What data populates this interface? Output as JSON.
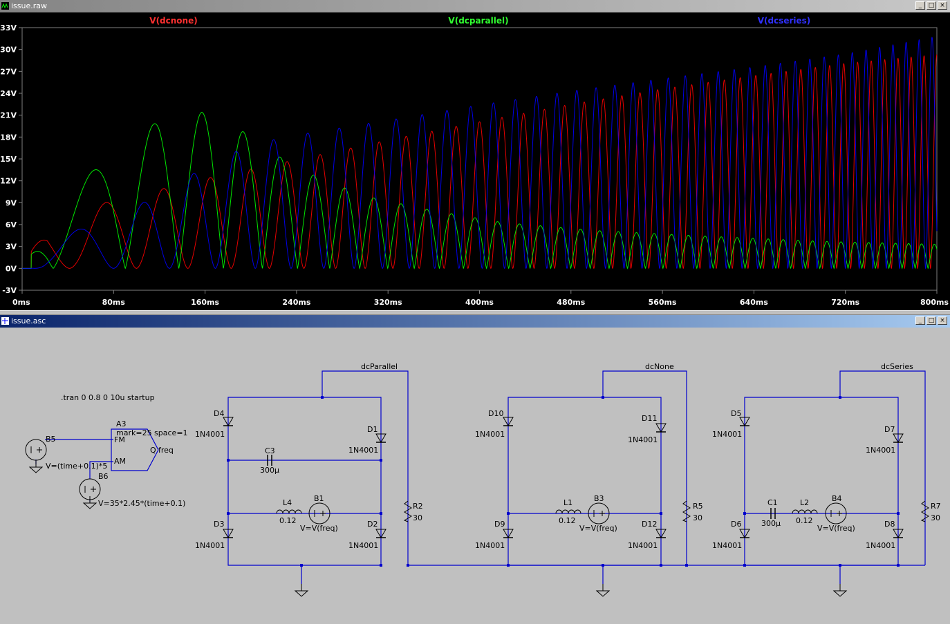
{
  "waveform_window": {
    "title": "issue.raw",
    "buttons": [
      "_",
      "□",
      "×"
    ]
  },
  "schematic_window": {
    "title": "issue.asc",
    "buttons": [
      "_",
      "□",
      "×"
    ]
  },
  "chart_data": {
    "type": "line",
    "series": [
      {
        "name": "V(dcnone)",
        "color": "#ff0000",
        "peak_envelope": [
          [
            22,
            6.8
          ],
          [
            58,
            8.4
          ],
          [
            88,
            9.6
          ],
          [
            120,
            10.8
          ],
          [
            160,
            12.3
          ],
          [
            200,
            13.6
          ],
          [
            240,
            14.9
          ],
          [
            320,
            17.6
          ],
          [
            400,
            20.1
          ],
          [
            480,
            22.5
          ],
          [
            560,
            24.6
          ],
          [
            640,
            26.4
          ],
          [
            720,
            28.1
          ],
          [
            800,
            29.3
          ]
        ]
      },
      {
        "name": "V(dcparallel)",
        "color": "#00ff00",
        "peak_envelope": [
          [
            22,
            8.8
          ],
          [
            55,
            12.5
          ],
          [
            80,
            15.6
          ],
          [
            100,
            17.9
          ],
          [
            120,
            20.4
          ],
          [
            140,
            21.1
          ],
          [
            157,
            21.4
          ],
          [
            175,
            20.7
          ],
          [
            190,
            19.1
          ],
          [
            210,
            16.9
          ],
          [
            230,
            14.8
          ],
          [
            260,
            12.4
          ],
          [
            300,
            9.9
          ],
          [
            360,
            7.9
          ],
          [
            420,
            6.3
          ],
          [
            500,
            5.2
          ],
          [
            600,
            4.4
          ],
          [
            700,
            3.7
          ],
          [
            800,
            3.3
          ]
        ]
      },
      {
        "name": "V(dcseries)",
        "color": "#0000ff",
        "peak_envelope": [
          [
            22,
            4.0
          ],
          [
            55,
            5.6
          ],
          [
            80,
            6.6
          ],
          [
            100,
            8.5
          ],
          [
            120,
            10.2
          ],
          [
            140,
            12.0
          ],
          [
            160,
            14.0
          ],
          [
            200,
            17.0
          ],
          [
            240,
            18.3
          ],
          [
            320,
            20.3
          ],
          [
            400,
            22.4
          ],
          [
            480,
            24.3
          ],
          [
            560,
            26.0
          ],
          [
            640,
            27.6
          ],
          [
            720,
            29.4
          ],
          [
            800,
            31.8
          ]
        ]
      }
    ],
    "xlabel": "",
    "ylabel": "",
    "xlim": [
      0,
      800
    ],
    "ylim": [
      -3,
      33
    ],
    "x_ticks": [
      "0ms",
      "80ms",
      "160ms",
      "240ms",
      "320ms",
      "400ms",
      "480ms",
      "560ms",
      "640ms",
      "720ms",
      "800ms"
    ],
    "y_ticks": [
      "-3V",
      "0V",
      "3V",
      "6V",
      "9V",
      "12V",
      "15V",
      "18V",
      "21V",
      "24V",
      "27V",
      "30V",
      "33V"
    ],
    "grid": false,
    "legend": "top"
  },
  "schematic": {
    "directive": ".tran 0 0.8 0 10u startup",
    "source_block": {
      "modulator_name": "A3",
      "modulator_params": "mark=25 space=1",
      "pin_fm": "FM",
      "pin_am": "AM",
      "pin_q": "Q",
      "out_net": "freq",
      "b5_name": "B5",
      "b5_expr": "V=(time+0.1)*5",
      "b6_name": "B6",
      "b6_expr": "V=35*2.45*(time+0.1)"
    },
    "sections": [
      {
        "net": "dcParallel",
        "d_tl": "D4",
        "d_tr": "D1",
        "d_bl": "D3",
        "d_br": "D2",
        "diode_model": "1N4001",
        "cap_name": "C3",
        "cap_value": "300µ",
        "ind_name": "L4",
        "ind_value": "0.12",
        "src_name": "B1",
        "src_expr": "V=V(freq)",
        "res_name": "R2",
        "res_value": "30"
      },
      {
        "net": "dcNone",
        "d_tl": "D10",
        "d_tr": "D11",
        "d_bl": "D9",
        "d_br": "D12",
        "diode_model": "1N4001",
        "ind_name": "L1",
        "ind_value": "0.12",
        "src_name": "B3",
        "src_expr": "V=V(freq)",
        "res_name": "R5",
        "res_value": "30"
      },
      {
        "net": "dcSeries",
        "d_tl": "D5",
        "d_tr": "D7",
        "d_bl": "D6",
        "d_br": "D8",
        "diode_model": "1N4001",
        "cap_name": "C1",
        "cap_value": "300µ",
        "ind_name": "L2",
        "ind_value": "0.12",
        "src_name": "B4",
        "src_expr": "V=V(freq)",
        "res_name": "R7",
        "res_value": "30"
      }
    ]
  }
}
